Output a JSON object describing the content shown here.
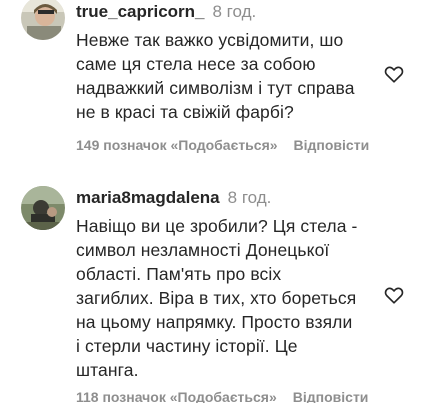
{
  "comments": [
    {
      "username": "true_capricorn_",
      "time": "8 год.",
      "text": "Невже так важко усвідомити, шо\nсаме ця стела несе за собою\nнадважкий символізм і тут справа\nне в красі та свіжій фарбі?",
      "likes": "149 позначок «Подобається»",
      "reply": "Відповісти",
      "like_icon": "heart-outline-icon"
    },
    {
      "username": "maria8magdalena",
      "time": "8 год.",
      "text": "Навіщо ви це зробили? Ця стела -\nсимвол незламності Донецької\nобласті. Пам'ять про всіх\nзагиблих. Віра в тих, хто бореться\nна цьому напрямку. Просто взяли\nі стерли частину історії. Це\nштанга.",
      "likes": "118 позначок «Подобається»",
      "reply": "Відповісти",
      "like_icon": "heart-outline-icon"
    }
  ],
  "colors": {
    "text": "#262626",
    "secondary": "#8e8e8e",
    "background": "#ffffff"
  }
}
